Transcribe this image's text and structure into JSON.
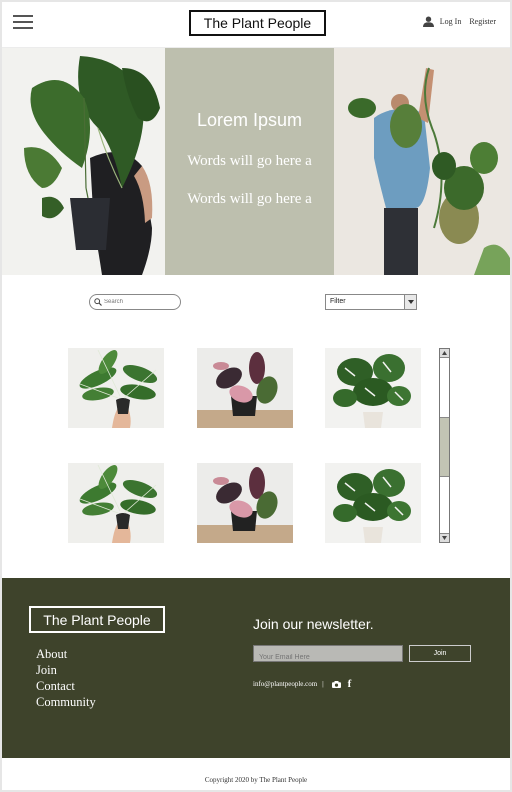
{
  "header": {
    "brand": "The Plant People",
    "login_label": "Log In",
    "register_label": "Register"
  },
  "hero": {
    "title": "Lorem Ipsum",
    "line1": "Words will go here a",
    "line2": "Words will go here a"
  },
  "controls": {
    "search_placeholder": "Search",
    "filter_label": "Filter"
  },
  "products": [
    {
      "plant": "calathea-white-stripe"
    },
    {
      "plant": "philodendron-pink-princess"
    },
    {
      "plant": "monstera"
    },
    {
      "plant": "calathea-white-stripe"
    },
    {
      "plant": "philodendron-pink-princess"
    },
    {
      "plant": "monstera"
    }
  ],
  "footer": {
    "brand": "The Plant People",
    "links": [
      "About",
      "Join",
      "Contact",
      "Community"
    ],
    "newsletter_title": "Join our newsletter.",
    "email_placeholder": "Your Email Here",
    "join_label": "Join",
    "email": "info@plantpeople.com",
    "separator": "|",
    "facebook_glyph": "f",
    "icons": [
      "camera-icon",
      "facebook-icon"
    ],
    "copyright": "Copyright 2020 by The Plant People"
  },
  "colors": {
    "hero_panel": "#bdbfae",
    "footer_bg": "#3e432b",
    "scroll_thumb": "#c2c4b4"
  }
}
